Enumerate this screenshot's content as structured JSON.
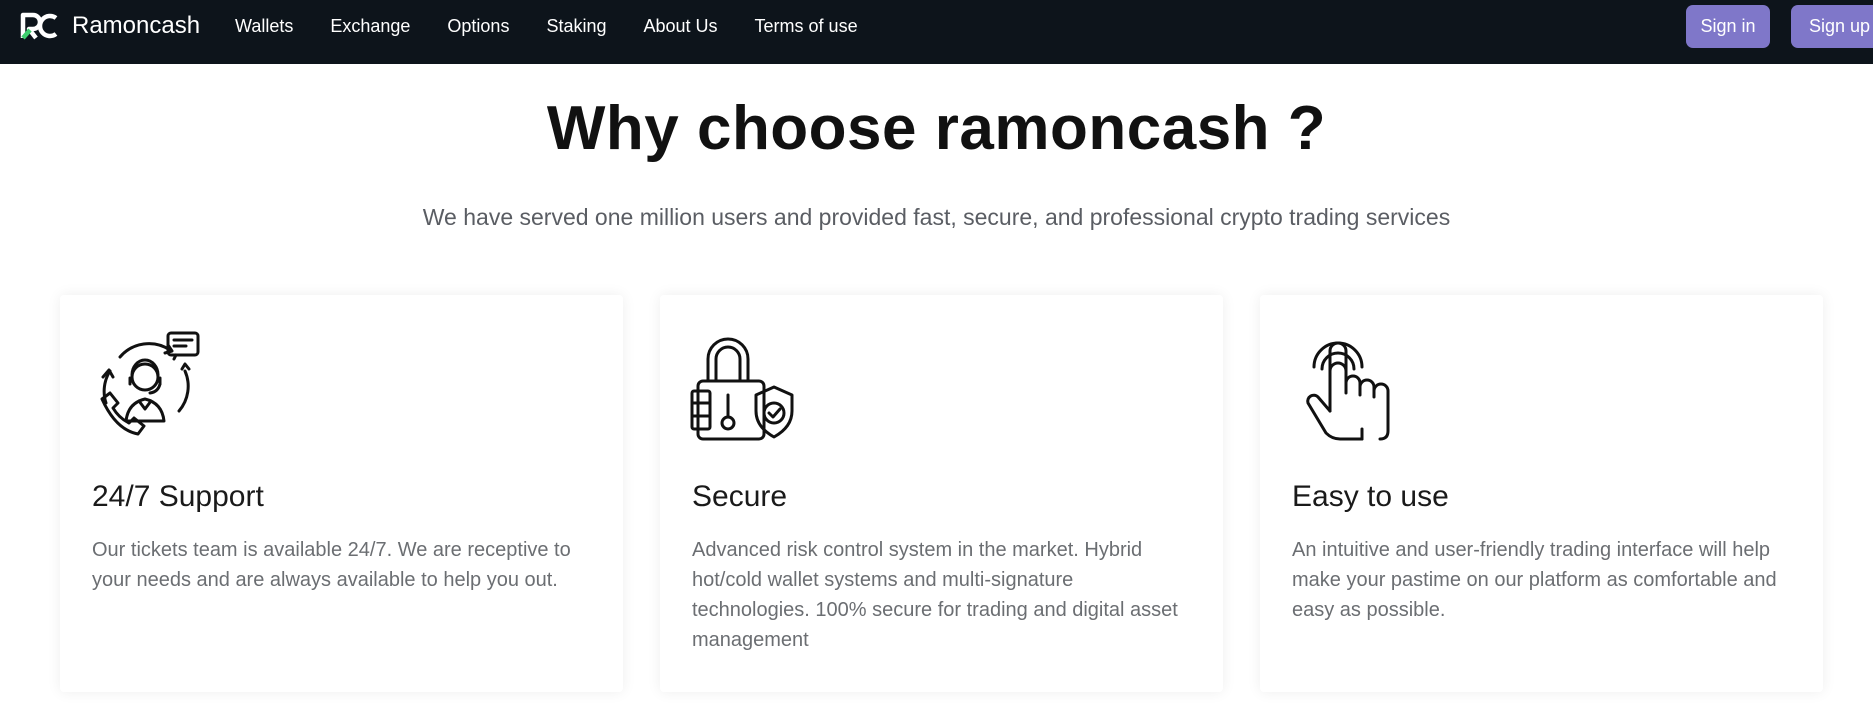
{
  "navbar": {
    "brand_name": "Ramoncash",
    "logo_icon": "rc-logo-icon",
    "links": [
      {
        "label": "Wallets"
      },
      {
        "label": "Exchange"
      },
      {
        "label": "Options"
      },
      {
        "label": "Staking"
      },
      {
        "label": "About Us"
      },
      {
        "label": "Terms of use"
      }
    ],
    "signin_label": "Sign in",
    "signup_label": "Sign up"
  },
  "hero": {
    "title": "Why choose ramoncash ?",
    "subtitle": "We have served one million users and provided fast, secure, and professional crypto trading services"
  },
  "features": [
    {
      "icon": "support-agent-icon",
      "title": "24/7 Support",
      "text": "Our tickets team is available 24/7. We are receptive to your needs and are always available to help you out."
    },
    {
      "icon": "padlock-shield-icon",
      "title": "Secure",
      "text": "Advanced risk control system in the market. Hybrid hot/cold wallet systems and multi-signature technologies. 100% secure for trading and digital asset management"
    },
    {
      "icon": "touch-hand-icon",
      "title": "Easy to use",
      "text": "An intuitive and user-friendly trading interface will help make your pastime on our platform as comfortable and easy as possible."
    }
  ],
  "colors": {
    "navbar_bg": "#0d141b",
    "button_bg": "#7f77c9",
    "logo_accent": "#3ecf6e"
  }
}
